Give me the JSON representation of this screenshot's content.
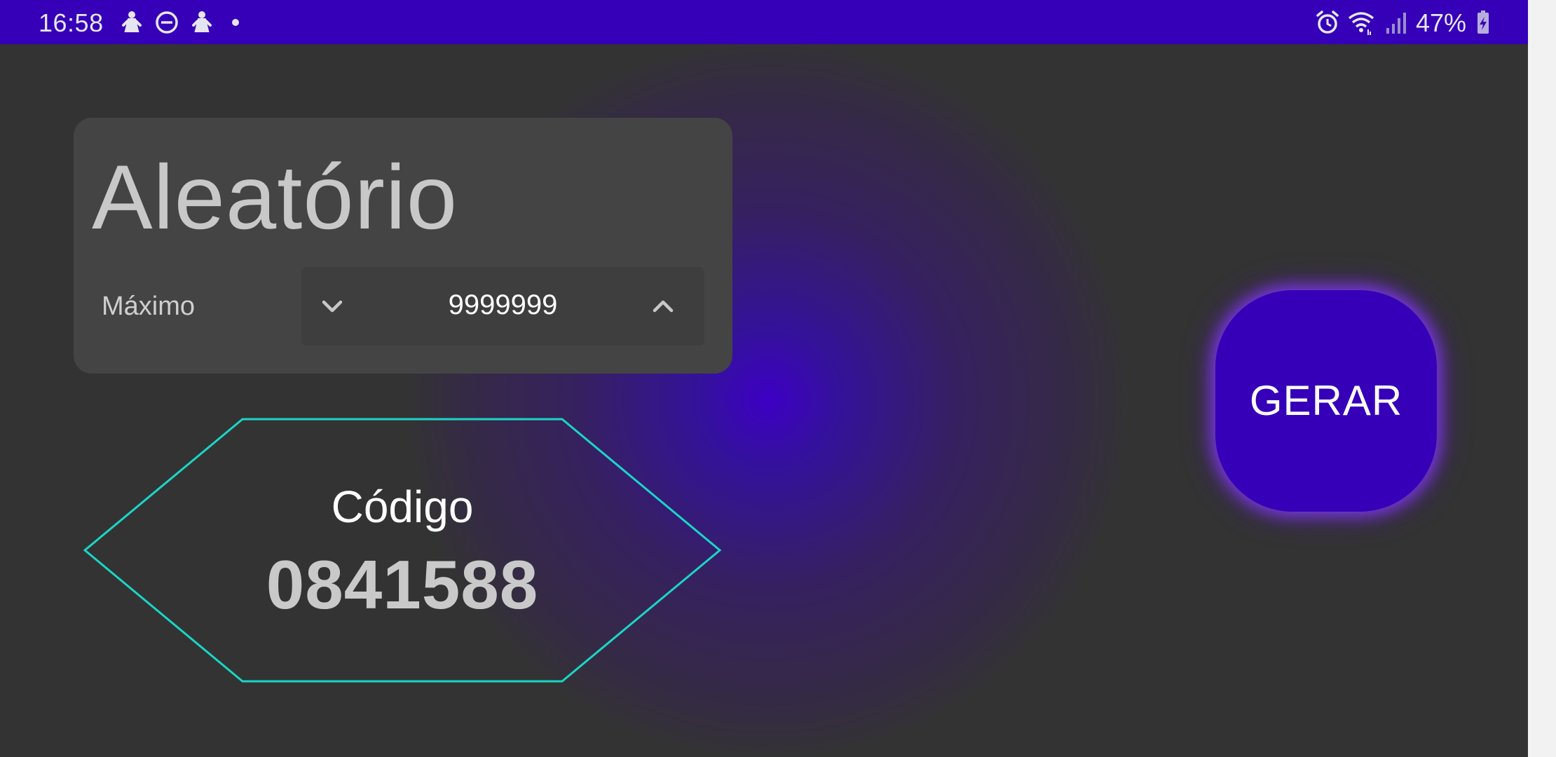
{
  "status_bar": {
    "time": "16:58",
    "left_icons": [
      "person-notification-icon",
      "do-not-disturb-icon",
      "person-notification-icon",
      "dot-icon"
    ],
    "right_icons": [
      "alarm-icon",
      "wifi-icon",
      "signal-icon",
      "battery-charging-icon"
    ],
    "battery_percent": "47%",
    "bar_color": "#3600b8"
  },
  "card": {
    "title": "Aleatório",
    "max_label": "Máximo",
    "stepper": {
      "value": "9999999",
      "decrement_icon": "chevron-down-icon",
      "increment_icon": "chevron-up-icon"
    }
  },
  "code_panel": {
    "label": "Código",
    "value": "0841588",
    "outline_color": "#1ad6c6"
  },
  "generate_button": {
    "label": "GERAR",
    "color": "#3600b8",
    "glow_color": "#8a3cf0"
  },
  "colors": {
    "background": "#333333",
    "card": "#444444",
    "accent": "#3600b8"
  }
}
